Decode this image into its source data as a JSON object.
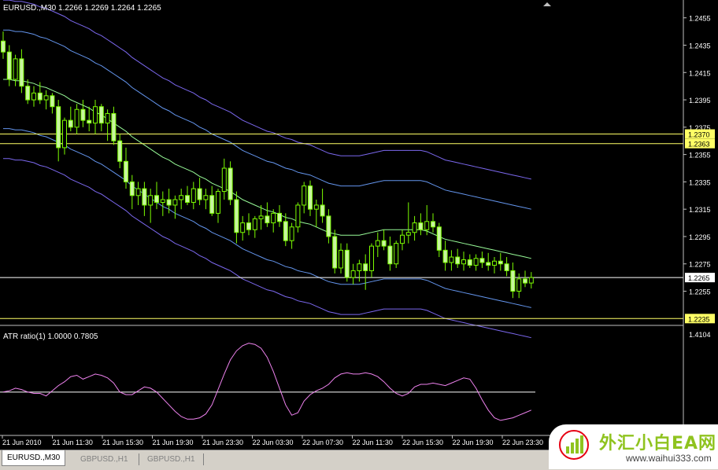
{
  "window": {
    "symbol_info": "EURUSD.,M30  1.2266 1.2269 1.2264 1.2265",
    "indicator_info": "ATR ratio(1) 1.0000 0.7805"
  },
  "price_axis": {
    "ticks": [
      "1.2455",
      "1.2435",
      "1.2415",
      "1.2395",
      "1.2375",
      "1.2355",
      "1.2335",
      "1.2315",
      "1.2295",
      "1.2275",
      "1.2255"
    ],
    "hlines": [
      {
        "label": "1.2370",
        "value": 1.237,
        "color": "#ffff66"
      },
      {
        "label": "1.2363",
        "value": 1.2363,
        "color": "#ffff66"
      },
      {
        "label": "1.2265",
        "value": 1.2265,
        "color": "#ffffff"
      },
      {
        "label": "1.2235",
        "value": 1.2235,
        "color": "#ffff66"
      }
    ]
  },
  "indicator_axis": {
    "ticks": [
      "1.4104"
    ],
    "level": 1.0
  },
  "time_axis": {
    "labels": [
      "21 Jun 2010",
      "21 Jun 11:30",
      "21 Jun 15:30",
      "21 Jun 19:30",
      "21 Jun 23:30",
      "22 Jun 03:30",
      "22 Jun 07:30",
      "22 Jun 11:30",
      "22 Jun 15:30",
      "22 Jun 19:30",
      "22 Jun 23:30"
    ]
  },
  "tabs": [
    {
      "label": "EURUSD.,M30",
      "active": true
    },
    {
      "label": "GBPUSD.,H1",
      "active": false
    },
    {
      "label": "GBPUSD.,H1",
      "active": false
    }
  ],
  "watermark": {
    "cn": "外汇小白EA网",
    "url": "www.waihui333.com"
  },
  "colors": {
    "background": "#000000",
    "candle": "#7cfc00",
    "candle_body_up": "#000000",
    "candle_body_down": "#c8f5a0",
    "band_outer": "#7b68ee",
    "band_inner": "#6495ed",
    "ma": "#98fb98",
    "atr_line": "#ee82ee"
  },
  "chart_data": {
    "type": "candlestick",
    "ylim": [
      1.223,
      1.246
    ],
    "candles": [
      [
        1.2438,
        1.2445,
        1.2425,
        1.243
      ],
      [
        1.243,
        1.2435,
        1.2405,
        1.241
      ],
      [
        1.241,
        1.2428,
        1.2405,
        1.2425
      ],
      [
        1.2425,
        1.2432,
        1.24,
        1.2405
      ],
      [
        1.2405,
        1.241,
        1.2392,
        1.2395
      ],
      [
        1.2395,
        1.2405,
        1.239,
        1.24
      ],
      [
        1.24,
        1.2408,
        1.2392,
        1.2395
      ],
      [
        1.2395,
        1.2402,
        1.2388,
        1.2398
      ],
      [
        1.2398,
        1.24,
        1.2385,
        1.239
      ],
      [
        1.239,
        1.2395,
        1.235,
        1.236
      ],
      [
        1.236,
        1.2382,
        1.2355,
        1.238
      ],
      [
        1.238,
        1.239,
        1.2372,
        1.2375
      ],
      [
        1.2375,
        1.2392,
        1.237,
        1.2388
      ],
      [
        1.2388,
        1.2395,
        1.2375,
        1.238
      ],
      [
        1.238,
        1.239,
        1.2372,
        1.2378
      ],
      [
        1.2378,
        1.2395,
        1.237,
        1.239
      ],
      [
        1.239,
        1.2392,
        1.2372,
        1.2378
      ],
      [
        1.2378,
        1.2388,
        1.2365,
        1.2385
      ],
      [
        1.2385,
        1.239,
        1.2362,
        1.2365
      ],
      [
        1.2365,
        1.237,
        1.2345,
        1.235
      ],
      [
        1.235,
        1.236,
        1.233,
        1.2335
      ],
      [
        1.2335,
        1.234,
        1.2315,
        1.2325
      ],
      [
        1.2325,
        1.2335,
        1.2318,
        1.233
      ],
      [
        1.233,
        1.2335,
        1.231,
        1.2318
      ],
      [
        1.2318,
        1.233,
        1.2305,
        1.2325
      ],
      [
        1.2325,
        1.2335,
        1.2315,
        1.232
      ],
      [
        1.232,
        1.2328,
        1.231,
        1.2322
      ],
      [
        1.2322,
        1.233,
        1.2312,
        1.2318
      ],
      [
        1.2318,
        1.2325,
        1.2308,
        1.2322
      ],
      [
        1.2322,
        1.233,
        1.2315,
        1.2325
      ],
      [
        1.2325,
        1.2332,
        1.2318,
        1.232
      ],
      [
        1.232,
        1.2335,
        1.2315,
        1.233
      ],
      [
        1.233,
        1.2338,
        1.2318,
        1.2322
      ],
      [
        1.2322,
        1.233,
        1.2315,
        1.2325
      ],
      [
        1.2325,
        1.2332,
        1.231,
        1.2312
      ],
      [
        1.2312,
        1.233,
        1.2305,
        1.2328
      ],
      [
        1.2328,
        1.2352,
        1.2322,
        1.2345
      ],
      [
        1.2345,
        1.235,
        1.2318,
        1.2322
      ],
      [
        1.2322,
        1.2328,
        1.229,
        1.2298
      ],
      [
        1.2298,
        1.231,
        1.2292,
        1.2305
      ],
      [
        1.2305,
        1.2312,
        1.2296,
        1.23
      ],
      [
        1.23,
        1.231,
        1.2294,
        1.2308
      ],
      [
        1.2308,
        1.2318,
        1.23,
        1.231
      ],
      [
        1.231,
        1.232,
        1.2302,
        1.2305
      ],
      [
        1.2305,
        1.2315,
        1.2298,
        1.2312
      ],
      [
        1.2312,
        1.2318,
        1.2302,
        1.2306
      ],
      [
        1.2306,
        1.2312,
        1.2288,
        1.2292
      ],
      [
        1.2292,
        1.2305,
        1.2286,
        1.2302
      ],
      [
        1.2302,
        1.232,
        1.2298,
        1.2318
      ],
      [
        1.2318,
        1.2335,
        1.2312,
        1.2332
      ],
      [
        1.2332,
        1.2336,
        1.231,
        1.2315
      ],
      [
        1.2315,
        1.2322,
        1.2302,
        1.2318
      ],
      [
        1.2318,
        1.233,
        1.2305,
        1.231
      ],
      [
        1.231,
        1.2315,
        1.229,
        1.2295
      ],
      [
        1.2295,
        1.23,
        1.2268,
        1.2272
      ],
      [
        1.2272,
        1.229,
        1.2268,
        1.2285
      ],
      [
        1.2285,
        1.229,
        1.2262,
        1.2265
      ],
      [
        1.2265,
        1.2275,
        1.226,
        1.227
      ],
      [
        1.227,
        1.2278,
        1.2262,
        1.2275
      ],
      [
        1.2275,
        1.2282,
        1.2256,
        1.227
      ],
      [
        1.227,
        1.229,
        1.2265,
        1.2288
      ],
      [
        1.2288,
        1.2298,
        1.228,
        1.2292
      ],
      [
        1.2292,
        1.23,
        1.2285,
        1.2288
      ],
      [
        1.2288,
        1.2295,
        1.227,
        1.2275
      ],
      [
        1.2275,
        1.2292,
        1.2272,
        1.229
      ],
      [
        1.229,
        1.23,
        1.2285,
        1.2296
      ],
      [
        1.2296,
        1.232,
        1.229,
        1.2298
      ],
      [
        1.2298,
        1.231,
        1.2292,
        1.2305
      ],
      [
        1.2305,
        1.2312,
        1.2296,
        1.23
      ],
      [
        1.23,
        1.2318,
        1.2296,
        1.2306
      ],
      [
        1.2306,
        1.2312,
        1.2298,
        1.2302
      ],
      [
        1.2302,
        1.2305,
        1.228,
        1.2285
      ],
      [
        1.2285,
        1.2292,
        1.227,
        1.2276
      ],
      [
        1.2276,
        1.2285,
        1.227,
        1.228
      ],
      [
        1.228,
        1.2286,
        1.2272,
        1.2275
      ],
      [
        1.2275,
        1.2284,
        1.227,
        1.2278
      ],
      [
        1.2278,
        1.2282,
        1.2272,
        1.2274
      ],
      [
        1.2274,
        1.2282,
        1.227,
        1.2279
      ],
      [
        1.2279,
        1.2284,
        1.2272,
        1.2276
      ],
      [
        1.2276,
        1.2283,
        1.227,
        1.2274
      ],
      [
        1.2274,
        1.228,
        1.2268,
        1.2277
      ],
      [
        1.2277,
        1.2283,
        1.227,
        1.2275
      ],
      [
        1.2275,
        1.228,
        1.2266,
        1.227
      ],
      [
        1.227,
        1.2276,
        1.225,
        1.2255
      ],
      [
        1.2255,
        1.2268,
        1.225,
        1.2264
      ],
      [
        1.2264,
        1.227,
        1.2258,
        1.2261
      ],
      [
        1.2261,
        1.2269,
        1.2257,
        1.2265
      ]
    ],
    "ma": [
      1.241,
      1.241,
      1.2409,
      1.2409,
      1.2408,
      1.2407,
      1.2405,
      1.2404,
      1.2402,
      1.24,
      1.2398,
      1.2395,
      1.2393,
      1.2391,
      1.2389,
      1.2386,
      1.2384,
      1.2381,
      1.2378,
      1.2375,
      1.2372,
      1.2368,
      1.2365,
      1.2362,
      1.2359,
      1.2356,
      1.2353,
      1.2351,
      1.2348,
      1.2346,
      1.2344,
      1.2342,
      1.2339,
      1.2337,
      1.2334,
      1.2332,
      1.233,
      1.2328,
      1.2325,
      1.2322,
      1.232,
      1.2318,
      1.2316,
      1.2314,
      1.2313,
      1.2311,
      1.2309,
      1.2308,
      1.2306,
      1.2305,
      1.2304,
      1.2302,
      1.23,
      1.2298,
      1.2297,
      1.2296,
      1.2296,
      1.2296,
      1.2296,
      1.2297,
      1.2298,
      1.2299,
      1.23,
      1.23,
      1.23,
      1.23,
      1.23,
      1.23,
      1.23,
      1.2299,
      1.2297,
      1.2295,
      1.2293,
      1.2292,
      1.2291,
      1.229,
      1.2289,
      1.2288,
      1.2287,
      1.2286,
      1.2285,
      1.2284,
      1.2283,
      1.2282,
      1.2281,
      1.228,
      1.2279
    ],
    "band_outer_width": 0.0058,
    "band_inner_width": 0.0036,
    "atr_ratio": [
      1.0,
      1.01,
      1.03,
      1.02,
      1.0,
      0.99,
      0.99,
      0.97,
      1.01,
      1.05,
      1.08,
      1.12,
      1.13,
      1.1,
      1.12,
      1.14,
      1.13,
      1.11,
      1.07,
      1.0,
      0.98,
      0.98,
      1.01,
      1.04,
      1.03,
      1.0,
      0.95,
      0.9,
      0.85,
      0.81,
      0.79,
      0.79,
      0.8,
      0.83,
      0.9,
      1.02,
      1.14,
      1.25,
      1.32,
      1.36,
      1.38,
      1.37,
      1.34,
      1.27,
      1.16,
      1.03,
      0.9,
      0.82,
      0.84,
      0.93,
      0.98,
      1.01,
      1.03,
      1.06,
      1.11,
      1.14,
      1.15,
      1.14,
      1.14,
      1.15,
      1.14,
      1.12,
      1.08,
      1.03,
      0.99,
      0.97,
      0.99,
      1.04,
      1.06,
      1.06,
      1.07,
      1.06,
      1.05,
      1.07,
      1.09,
      1.11,
      1.1,
      1.03,
      0.94,
      0.86,
      0.8,
      0.78,
      0.79,
      0.8,
      0.82,
      0.84,
      0.86
    ]
  }
}
